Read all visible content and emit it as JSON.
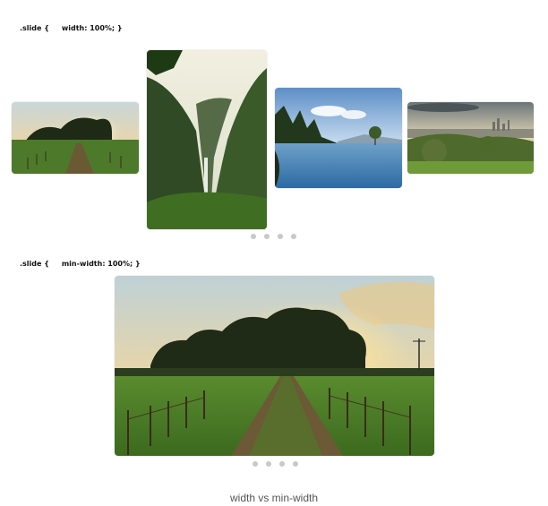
{
  "demo_width": {
    "code_label": ".slide {     width: 100%; }",
    "slides": [
      {
        "scene": "sunset-tree-field",
        "alt_icon": "landscape-image"
      },
      {
        "scene": "waterfall-valley",
        "alt_icon": "landscape-image"
      },
      {
        "scene": "lake-lone-tree",
        "alt_icon": "landscape-image"
      },
      {
        "scene": "city-countryside",
        "alt_icon": "landscape-image"
      }
    ],
    "pager_count": 4
  },
  "demo_min_width": {
    "code_label": ".slide {     min-width: 100%; }",
    "slides": [
      {
        "scene": "sunset-tree-field",
        "alt_icon": "landscape-image"
      }
    ],
    "pager_count": 4
  },
  "caption": "width vs min-width",
  "colors": {
    "dot": "#c8c8c8",
    "caption": "#555555",
    "code": "#111111"
  }
}
